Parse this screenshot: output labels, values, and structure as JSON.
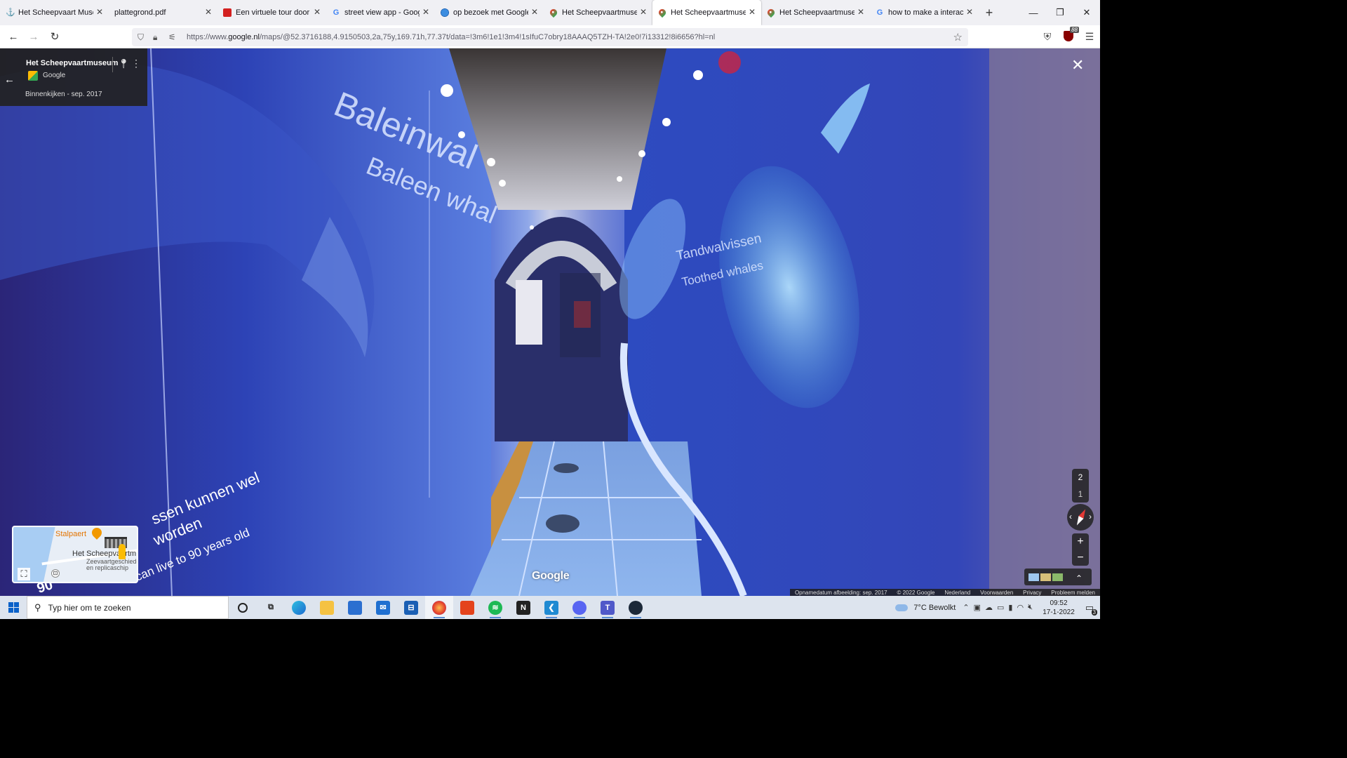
{
  "browser": {
    "tabs": [
      {
        "label": "Het Scheepvaart Museum",
        "favicon": "anchor-icon",
        "active": false
      },
      {
        "label": "plattegrond.pdf",
        "favicon": "",
        "active": false
      },
      {
        "label": "Een virtuele tour door m",
        "favicon": "red-logo-icon",
        "active": false
      },
      {
        "label": "street view app - Google",
        "favicon": "google-icon",
        "active": false
      },
      {
        "label": "op bezoek met Google St",
        "favicon": "globe-icon",
        "active": false
      },
      {
        "label": "Het Scheepvaartmuseum",
        "favicon": "maps-icon",
        "active": false
      },
      {
        "label": "Het Scheepvaartmuseum",
        "favicon": "maps-icon",
        "active": true
      },
      {
        "label": "Het Scheepvaartmuseum",
        "favicon": "maps-icon",
        "active": false
      },
      {
        "label": "how to make a interactiv",
        "favicon": "google-icon",
        "active": false
      }
    ],
    "url": {
      "prefix": "https://www.",
      "domain": "google.nl",
      "path": "/maps/@52.3716188,4.9150503,2a,75y,169.71h,77.37t/data=!3m6!1e1!3m4!1sIfuC7obry18AAAQ5TZH-TA!2e0!7i13312!8i6656?hl=nl"
    },
    "ublock_count": "88"
  },
  "streetview": {
    "place_title": "Het Scheepvaartmuseum",
    "provider": "Google",
    "capture_date": "Binnenkijken - sep. 2017",
    "wall_texts": {
      "baleen_nl": "Baleinwal",
      "baleen_en": "Baleen whal",
      "toothed_nl": "Tandwalvissen",
      "toothed_en": "Toothed whales",
      "age_nl_1": "ssen kunnen wel",
      "age_nl_2": "worden",
      "age_en": "can live to 90 years old",
      "age_frag": "90"
    },
    "floors": [
      "2",
      "1"
    ],
    "selected_floor": "1",
    "watermark": "Google",
    "footer": [
      "Opnamedatum afbeelding: sep. 2017",
      "© 2022 Google",
      "Nederland",
      "Voorwaarden",
      "Privacy",
      "Probleem melden"
    ]
  },
  "minimap": {
    "poi_label": "Stalpaert",
    "place_label": "Het Scheepvaartm",
    "sub_label_1": "Zeevaartgeschiede",
    "sub_label_2": "en replicaschip"
  },
  "taskbar": {
    "search_placeholder": "Typ hier om te zoeken",
    "apps": [
      "cortana-icon",
      "task-view-icon",
      "edge-icon",
      "file-explorer-icon",
      "store-icon",
      "mail-icon",
      "remote-desktop-icon",
      "firefox-icon",
      "office-icon",
      "spotify-icon",
      "notion-icon",
      "vscode-icon",
      "discord-icon",
      "teams-icon",
      "steam-icon"
    ],
    "weather": "7°C  Bewolkt",
    "time": "09:52",
    "date": "17-1-2022",
    "notifications": "3"
  },
  "colors": {
    "accent": "#1a73e8",
    "tab_strip": "#f0f0f4",
    "panel": "#222222"
  }
}
